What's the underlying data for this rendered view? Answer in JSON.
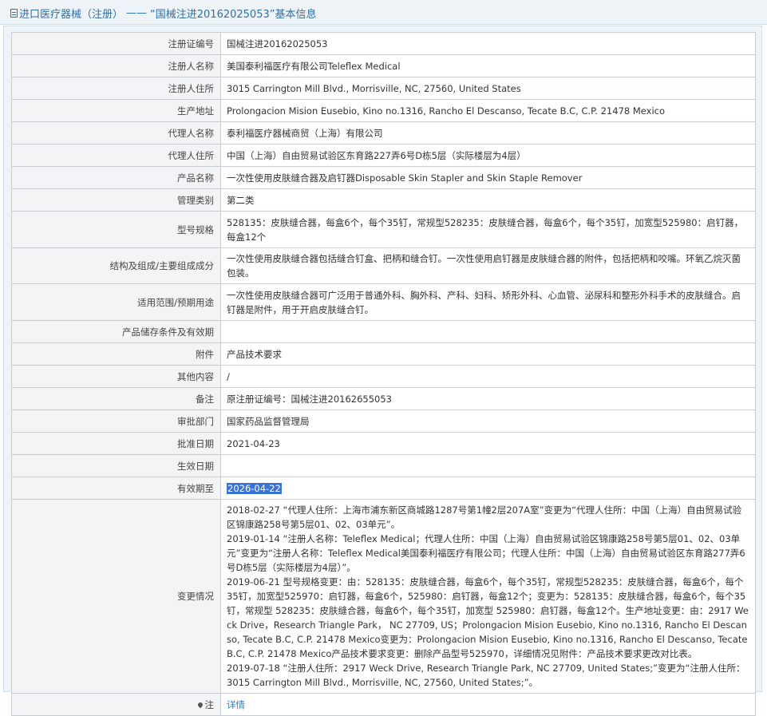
{
  "page": {
    "title_prefix": "进口医疗器械（注册）",
    "title_dash": "——",
    "title_main": "“国械注进20162025053”基本信息"
  },
  "rows": [
    {
      "label": "注册证编号",
      "value": "国械注进20162025053"
    },
    {
      "label": "注册人名称",
      "value": "美国泰利福医疗有限公司Teleflex Medical"
    },
    {
      "label": "注册人住所",
      "value": "3015 Carrington Mill Blvd., Morrisville, NC, 27560, United States"
    },
    {
      "label": "生产地址",
      "value": "Prolongacion Mision Eusebio, Kino no.1316, Rancho El Descanso, Tecate B.C, C.P. 21478 Mexico"
    },
    {
      "label": "代理人名称",
      "value": "泰利福医疗器械商贸（上海）有限公司"
    },
    {
      "label": "代理人住所",
      "value": "中国（上海）自由贸易试验区东育路227弄6号D栋5层（实际楼层为4层）"
    },
    {
      "label": "产品名称",
      "value": "一次性使用皮肤缝合器及启钉器Disposable Skin Stapler and Skin Staple Remover"
    },
    {
      "label": "管理类别",
      "value": "第二类"
    },
    {
      "label": "型号规格",
      "value": "528135：皮肤缝合器，每盒6个，每个35钉，常规型528235：皮肤缝合器，每盒6个，每个35钉，加宽型525980：启钉器，每盒12个"
    },
    {
      "label": "结构及组成/主要组成成分",
      "value": "一次性使用皮肤缝合器包括缝合钉盒、把柄和缝合钉。一次性使用启钉器是皮肤缝合器的附件，包括把柄和咬嘴。环氧乙烷灭菌包装。"
    },
    {
      "label": "适用范围/预期用途",
      "value": "一次性使用皮肤缝合器可广泛用于普通外科、胸外科、产科、妇科、矫形外科、心血管、泌尿科和整形外科手术的皮肤缝合。启钉器是附件，用于开启皮肤缝合钉。"
    },
    {
      "label": "产品储存条件及有效期",
      "value": ""
    },
    {
      "label": "附件",
      "value": "产品技术要求"
    },
    {
      "label": "其他内容",
      "value": "/"
    },
    {
      "label": "备注",
      "value": "原注册证编号：国械注进20162655053"
    },
    {
      "label": "审批部门",
      "value": "国家药品监督管理局"
    },
    {
      "label": "批准日期",
      "value": "2021-04-23"
    },
    {
      "label": "生效日期",
      "value": ""
    },
    {
      "label": "有效期至",
      "value": "2026-04-22"
    }
  ],
  "changes": {
    "label": "变更情况",
    "entries": [
      "2018-02-27 “代理人住所：上海市浦东新区商城路1287号第1幢2层207A室”变更为“代理人住所：中国（上海）自由贸易试验区锦康路258号第5层01、02、03单元”。",
      "2019-01-14 “注册人名称：Teleflex Medical；代理人住所：中国（上海）自由贸易试验区锦康路258号第5层01、02、03单元”变更为“注册人名称：Teleflex Medical美国泰利福医疗有限公司；代理人住所：中国（上海）自由贸易试验区东育路277弄6号D栋5层（实际楼层为4层）”。",
      "2019-06-21 型号规格变更：由：528135：皮肤缝合器，每盒6个，每个35钉，常规型528235：皮肤缝合器，每盒6个，每个35钉，加宽型525970：启钉器，每盒6个，525980：启钉器，每盒12个；变更为：528135：皮肤缝合器，每盒6个，每个35钉，常规型 528235：皮肤缝合器，每盒6个，每个35钉，加宽型 525980：启钉器，每盒12个。生产地址变更：由：2917 Weck Drive，Research Triangle Park， NC 27709, US；Prolongacion Mision Eusebio, Kino no.1316, Rancho El Descanso, Tecate B.C, C.P. 21478 Mexico变更为：Prolongacion Mision Eusebio, Kino no.1316, Rancho El Descanso, Tecate B.C, C.P. 21478 Mexico产品技术要求变更：删除产品型号525970，详细情况见附件：产品技术要求更改对比表。",
      "2019-07-18 “注册人住所：2917 Weck Drive, Research Triangle Park, NC 27709, United States;”变更为“注册人住所：3015 Carrington Mill Blvd., Morrisville, NC, 27560, United States;”。"
    ]
  },
  "note": {
    "label": "注",
    "link": "详情"
  }
}
